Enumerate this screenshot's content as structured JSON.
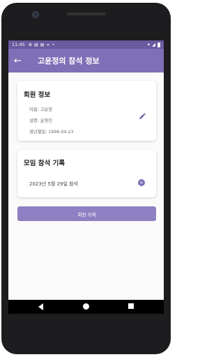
{
  "status_bar": {
    "time": "11:45",
    "icons": [
      "gear-icon",
      "message-icon",
      "message-icon",
      "voicemail-icon",
      "dot-icon"
    ],
    "right_icons": [
      "wifi-icon",
      "signal-icon",
      "battery-icon"
    ]
  },
  "app_bar": {
    "back_icon": "←",
    "title": "고윤정의 참석 정보"
  },
  "member_card": {
    "heading": "회원 정보",
    "name": "이름: 고윤정",
    "description": "설명: 윤영진",
    "birthdate": "생년월일: 1996.04.23",
    "edit_icon": "pencil-icon"
  },
  "attendance_card": {
    "heading": "모임 참석 기록",
    "records": [
      {
        "text": "2023년 5월 29일 참석"
      }
    ],
    "remove_icon": "×"
  },
  "delete_button": {
    "label": "회원 삭제"
  },
  "colors": {
    "app_bar": "#7e6fb6",
    "status_bar": "#6a5aa0",
    "button": "#8e80c2"
  }
}
